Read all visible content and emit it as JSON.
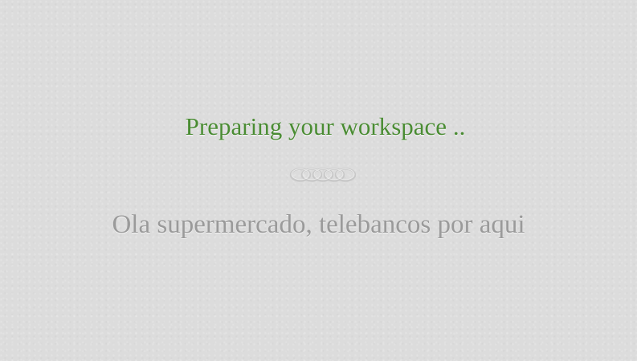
{
  "loading": {
    "title": "Preparing your workspace ..",
    "message": "Ola supermercado, telebancos por aqui"
  },
  "icons": {
    "divider": "ornamental-divider-icon"
  },
  "colors": {
    "background": "#dcdcdc",
    "title": "#4a8c33",
    "message": "#9a9a9a",
    "divider": "#c4c4c4"
  }
}
